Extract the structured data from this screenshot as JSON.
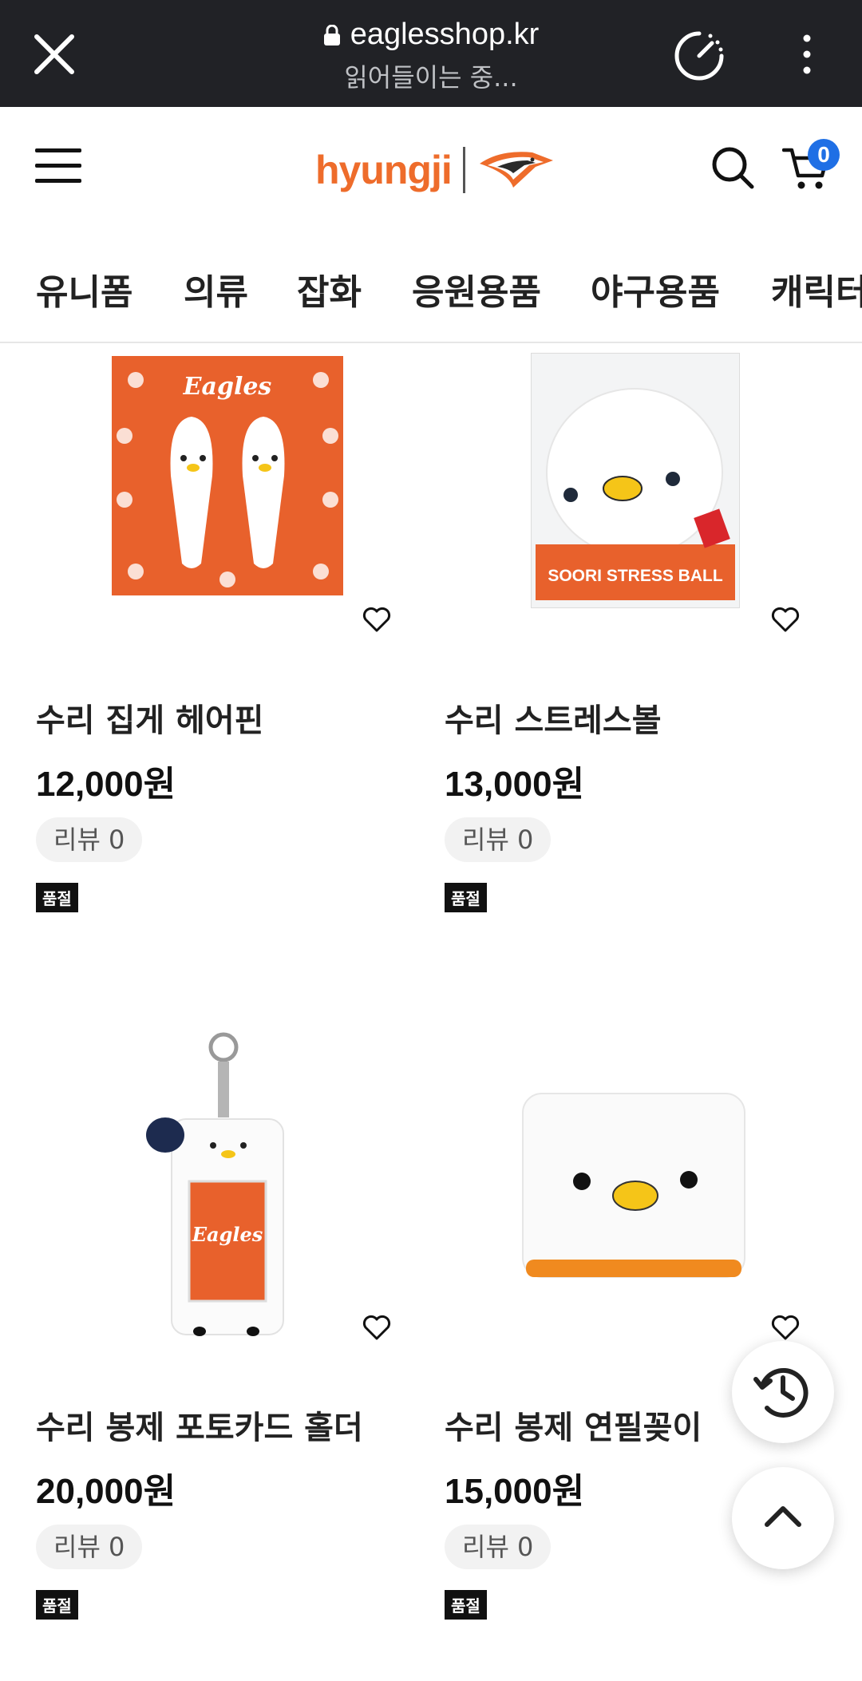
{
  "browser": {
    "url": "eaglesshop.kr",
    "status": "읽어들이는 중..."
  },
  "header": {
    "logo_text": "hyungji",
    "cart_count": "0"
  },
  "categories": [
    "유니폼",
    "의류",
    "잡화",
    "응원용품",
    "야구용품",
    "캐릭터"
  ],
  "products": [
    {
      "name": "수리 집게 헤어핀",
      "price": "12,000원",
      "review": "리뷰 0",
      "status": "품절"
    },
    {
      "name": "수리 스트레스볼",
      "price": "13,000원",
      "review": "리뷰 0",
      "status": "품절",
      "package_text": "SOORI STRESS BALL"
    },
    {
      "name": "수리 봉제 포토카드 홀더",
      "price": "20,000원",
      "review": "리뷰 0",
      "status": "품절"
    },
    {
      "name": "수리 봉제 연필꽂이",
      "price": "15,000원",
      "review": "리뷰 0",
      "status": "품절"
    }
  ],
  "colors": {
    "topbar": "#212226",
    "brand_orange": "#ee6c2b",
    "badge_blue": "#1f6fe5"
  },
  "icons": [
    "close-icon",
    "lock-icon",
    "speed-icon",
    "kebab-menu-icon",
    "hamburger-menu-icon",
    "eagle-logo-icon",
    "search-icon",
    "cart-icon",
    "heart-icon",
    "history-icon",
    "chevron-up-icon"
  ]
}
